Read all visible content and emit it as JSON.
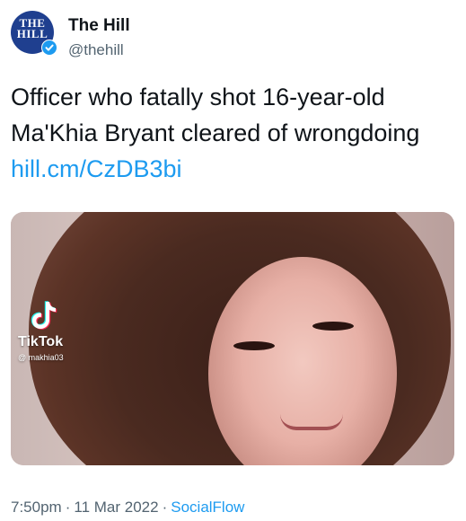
{
  "account": {
    "avatar_text": "THE\nHILL",
    "display_name": "The Hill",
    "handle": "@thehill",
    "verified_icon": "verified-badge-icon",
    "brand_color": "#1f3f8f"
  },
  "tweet": {
    "text": "Officer who fatally shot 16-year-old Ma'Khia Bryant cleared of wrongdoing ",
    "link": "hill.cm/CzDB3bi",
    "link_color": "#1d9bf0"
  },
  "media": {
    "watermark_app": "TikTok",
    "watermark_handle": "@ makhia03",
    "watermark_icon": "tiktok-logo-icon"
  },
  "meta": {
    "time": "7:50pm",
    "separator": "·",
    "date": "11 Mar 2022",
    "source": "SocialFlow"
  }
}
